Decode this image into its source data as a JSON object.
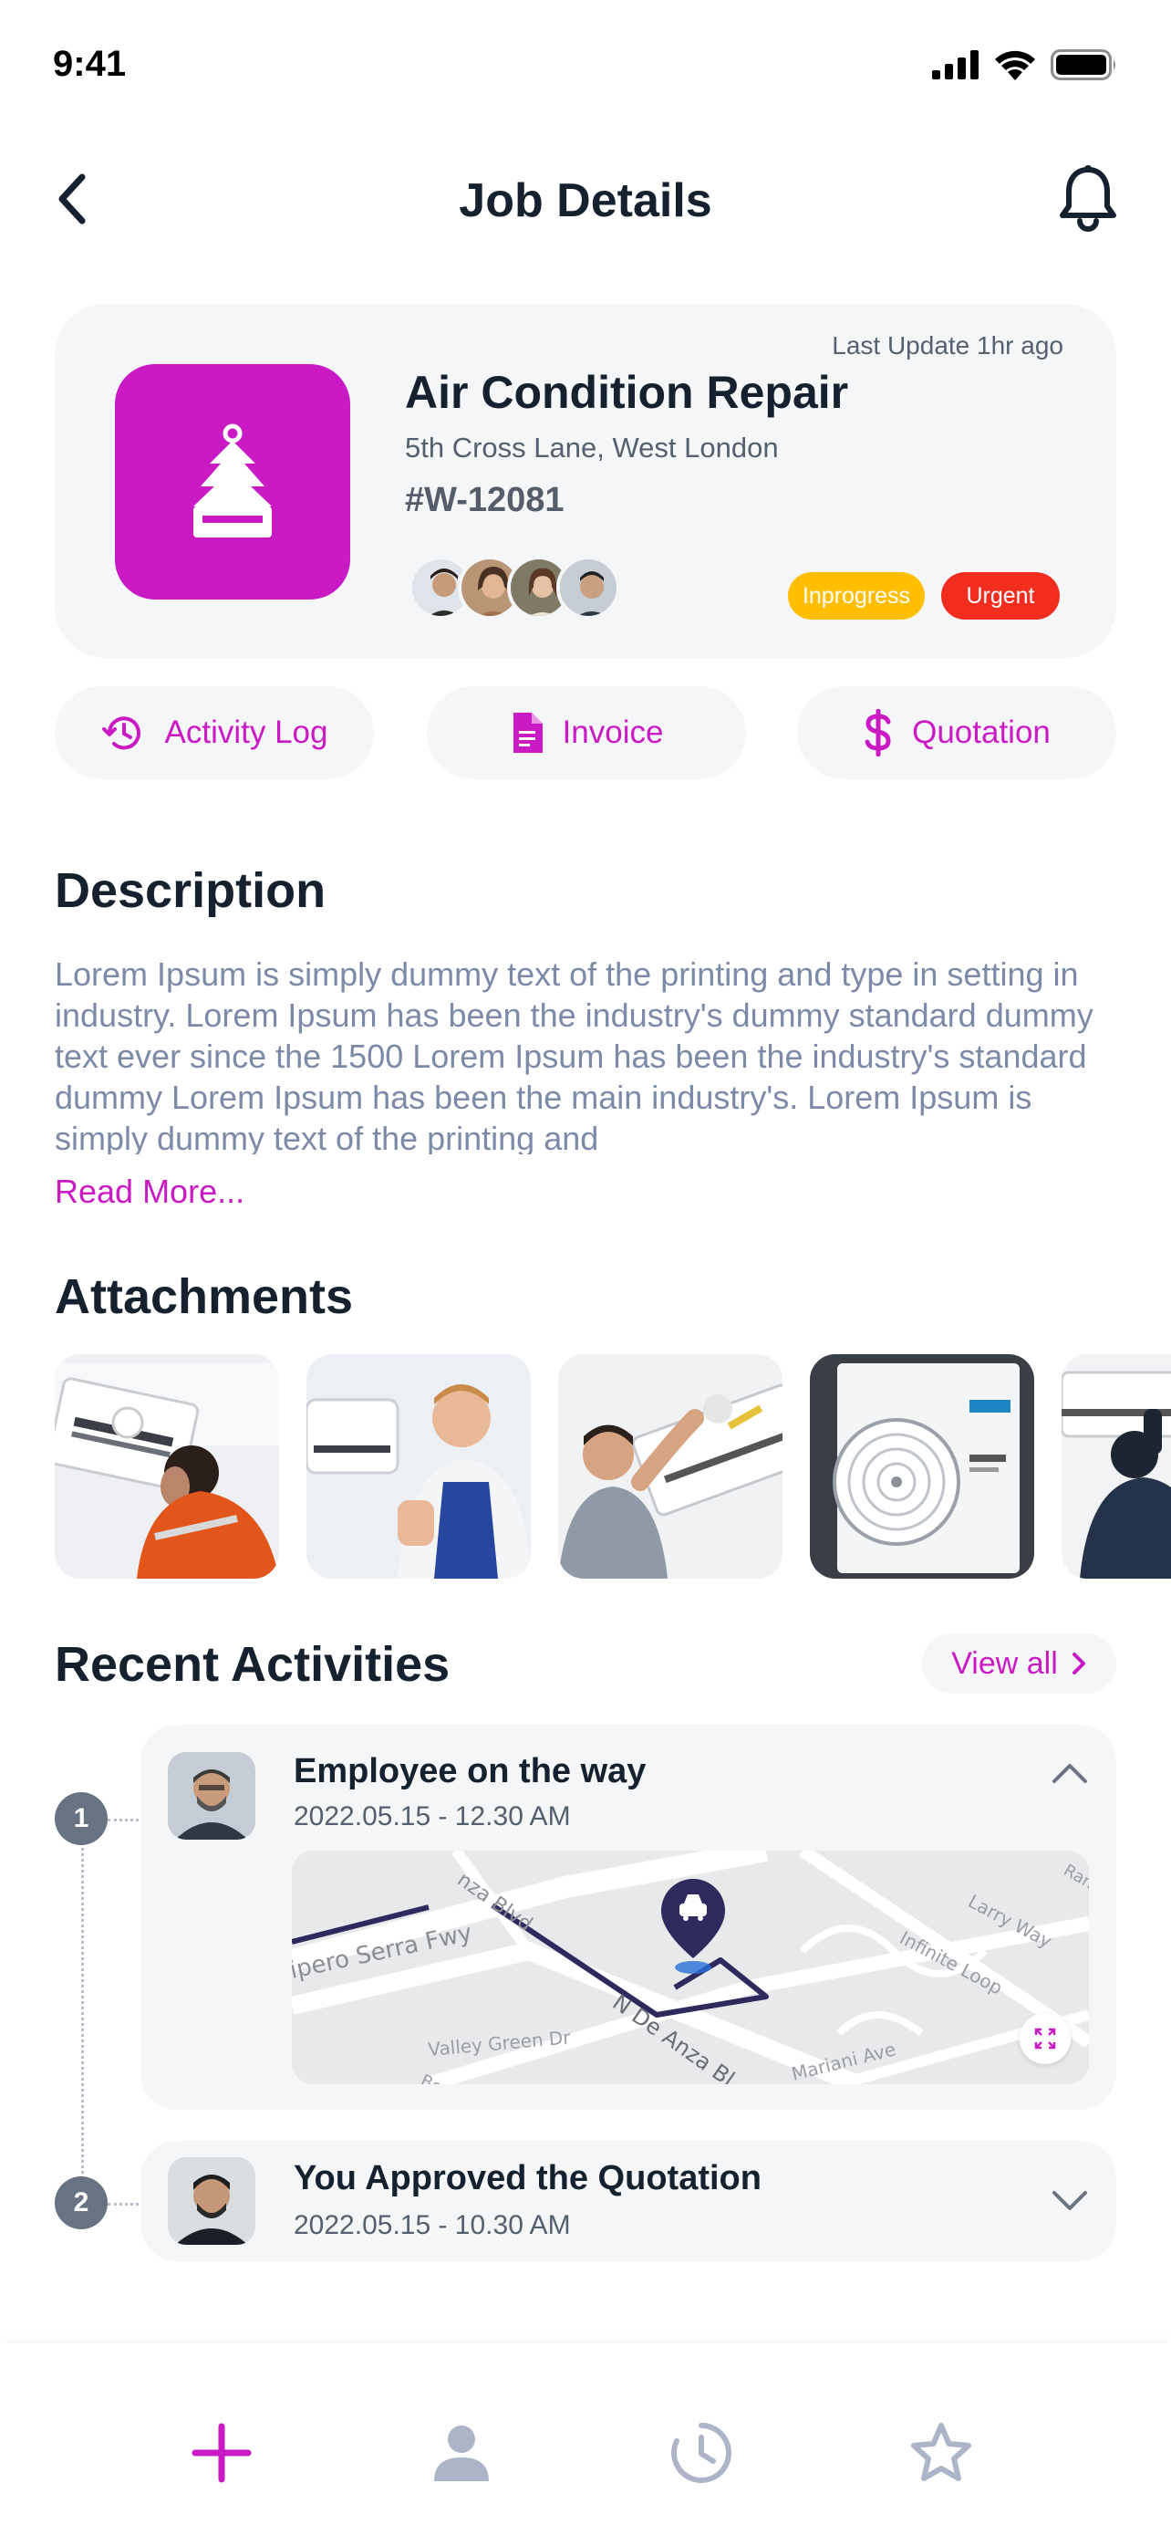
{
  "status_bar": {
    "time": "9:41"
  },
  "header": {
    "title": "Job Details"
  },
  "job": {
    "last_update": "Last Update 1hr ago",
    "title": "Air Condition Repair",
    "address": "5th Cross Lane, West London",
    "code": "#W-12081",
    "status_badge": "Inprogress",
    "priority_badge": "Urgent",
    "colors": {
      "accent": "#c91ac4",
      "inprogress": "#ffbf00",
      "urgent": "#f02d1e"
    }
  },
  "actions": {
    "activity_log": "Activity Log",
    "invoice": "Invoice",
    "quotation": "Quotation"
  },
  "description": {
    "title": "Description",
    "text": "Lorem Ipsum is simply dummy text of the printing and type in setting in industry. Lorem Ipsum has been the industry's dummy standard dummy text ever since the 1500 Lorem Ipsum has been the industry's standard dummy Lorem Ipsum has been the main industry's. Lorem Ipsum is simply dummy text of the printing and",
    "read_more": "Read More..."
  },
  "attachments": {
    "title": "Attachments"
  },
  "recent": {
    "title": "Recent Activities",
    "view_all": "View all",
    "items": [
      {
        "number": "1",
        "title": "Employee on the way",
        "date": "2022.05.15 - 12.30 AM",
        "expanded": true
      },
      {
        "number": "2",
        "title": "You Approved the Quotation",
        "date": "2022.05.15 - 10.30 AM",
        "expanded": false
      }
    ],
    "map_labels": [
      "nza Blvd",
      "ipero Serra Fwy",
      "Valley Green Dr",
      "N De Anza Bl",
      "Larry Way",
      "Infinite Loop",
      "Mariani Ave",
      "Ran",
      "Be"
    ]
  },
  "bottom_nav": {
    "items": [
      "plus-icon",
      "user-icon",
      "clock-icon",
      "star-icon"
    ]
  }
}
